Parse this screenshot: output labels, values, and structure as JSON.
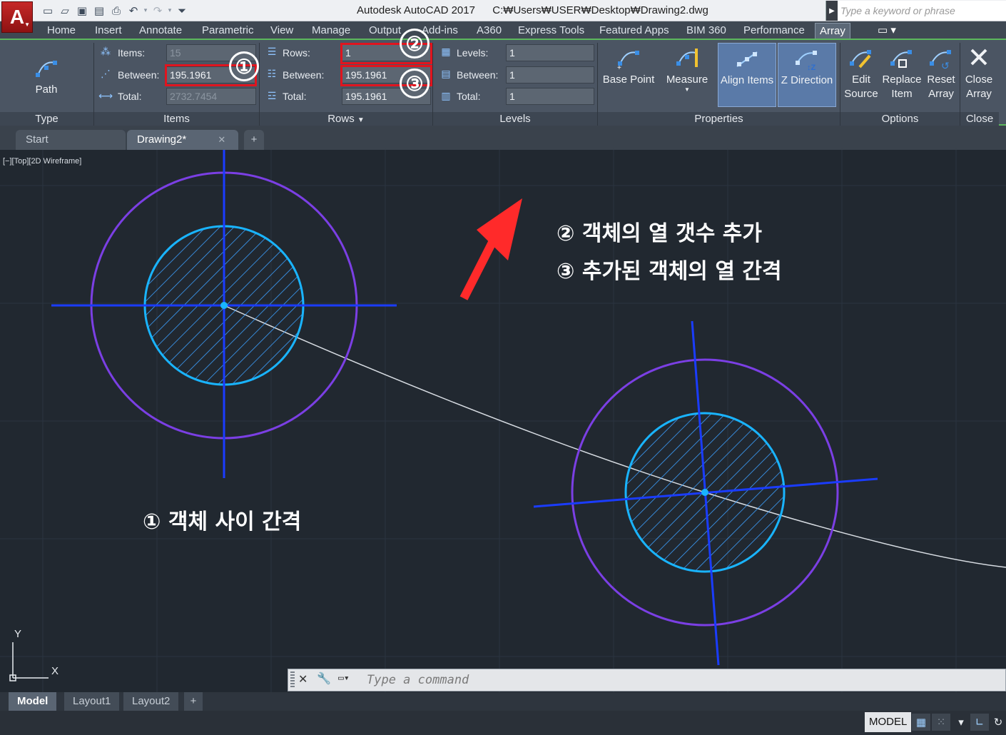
{
  "app": {
    "title": "Autodesk AutoCAD 2017",
    "file_path": "C:₩Users₩USER₩Desktop₩Drawing2.dwg",
    "app_button_letter": "A"
  },
  "search": {
    "placeholder": "Type a keyword or phrase"
  },
  "ribbon_tabs": [
    {
      "label": "Home"
    },
    {
      "label": "Insert"
    },
    {
      "label": "Annotate"
    },
    {
      "label": "Parametric"
    },
    {
      "label": "View"
    },
    {
      "label": "Manage"
    },
    {
      "label": "Output"
    },
    {
      "label": "Add-ins"
    },
    {
      "label": "A360"
    },
    {
      "label": "Express Tools"
    },
    {
      "label": "Featured Apps"
    },
    {
      "label": "BIM 360"
    },
    {
      "label": "Performance"
    },
    {
      "label": "Array"
    }
  ],
  "ribbon": {
    "type_panel": {
      "title": "Type",
      "path_label": "Path"
    },
    "items_panel": {
      "title": "Items",
      "items_label": "Items:",
      "items_value": "15",
      "between_label": "Between:",
      "between_value": "195.1961",
      "total_label": "Total:",
      "total_value": "2732.7454"
    },
    "rows_panel": {
      "title": "Rows",
      "rows_label": "Rows:",
      "rows_value": "1",
      "between_label": "Between:",
      "between_value": "195.1961",
      "total_label": "Total:",
      "total_value": "195.1961"
    },
    "levels_panel": {
      "title": "Levels",
      "levels_label": "Levels:",
      "levels_value": "1",
      "between_label": "Between:",
      "between_value": "1",
      "total_label": "Total:",
      "total_value": "1"
    },
    "properties_panel": {
      "title": "Properties",
      "base_point": "Base Point",
      "measure": "Measure",
      "align_items": "Align Items",
      "z_direction": "Z Direction"
    },
    "options_panel": {
      "title": "Options",
      "edit_source_1": "Edit",
      "edit_source_2": "Source",
      "replace_item_1": "Replace",
      "replace_item_2": "Item",
      "reset_array_1": "Reset",
      "reset_array_2": "Array"
    },
    "close_panel": {
      "title": "Close",
      "close_array_1": "Close",
      "close_array_2": "Array"
    }
  },
  "callouts": {
    "one": "①",
    "two": "②",
    "three": "③"
  },
  "file_tabs": {
    "start": "Start",
    "drawing": "Drawing2*",
    "close": "✕",
    "add": "+"
  },
  "viewport_label": "[−][Top][2D Wireframe]",
  "annotations": {
    "two": "②  객체의 열 갯수 추가",
    "three": "③  추가된 객체의 열 간격",
    "one": "①  객체 사이 간격"
  },
  "ucs": {
    "y": "Y",
    "x": "X"
  },
  "command_line": {
    "placeholder": "Type a command"
  },
  "layout_tabs": {
    "model": "Model",
    "layout1": "Layout1",
    "layout2": "Layout2",
    "add": "+"
  },
  "status": {
    "model": "MODEL"
  },
  "colors": {
    "accent_red": "#e0141e",
    "ribbon_green": "#5cb85c",
    "canvas_bg": "#212830",
    "outer_circle": "#7b3fe4",
    "inner_circle": "#19b4ff",
    "axis_line": "#1a3cff"
  }
}
